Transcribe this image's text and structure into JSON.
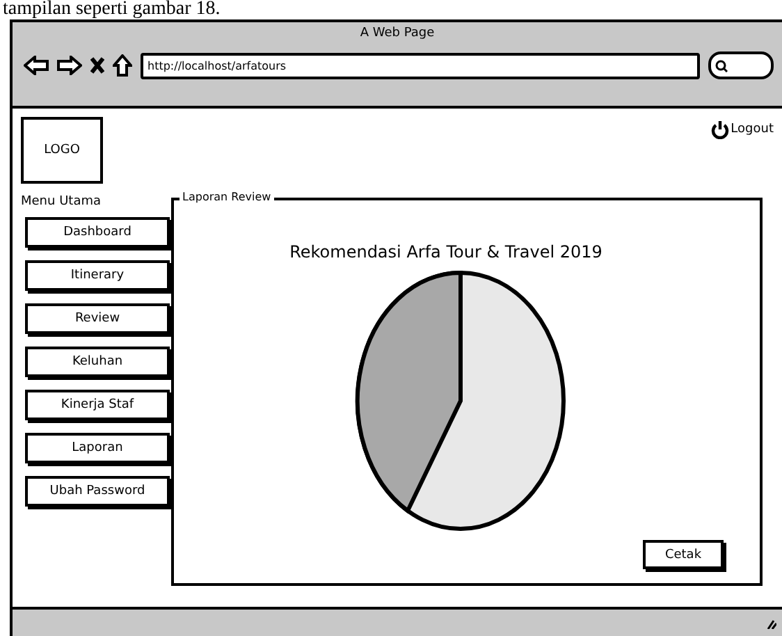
{
  "document_text": "tampilan seperti gambar 18.",
  "window": {
    "title": "A Web Page",
    "url": "http://localhost/arfatours"
  },
  "header": {
    "logo": "LOGO",
    "logout": "Logout"
  },
  "sidebar": {
    "heading": "Menu Utama",
    "items": [
      {
        "label": "Dashboard"
      },
      {
        "label": "Itinerary"
      },
      {
        "label": "Review"
      },
      {
        "label": "Keluhan"
      },
      {
        "label": "Kinerja Staf"
      },
      {
        "label": "Laporan"
      },
      {
        "label": "Ubah Password"
      }
    ]
  },
  "panel": {
    "title": "Laporan Review",
    "chart_title": "Rekomendasi Arfa Tour & Travel 2019",
    "button": "Cetak"
  }
}
